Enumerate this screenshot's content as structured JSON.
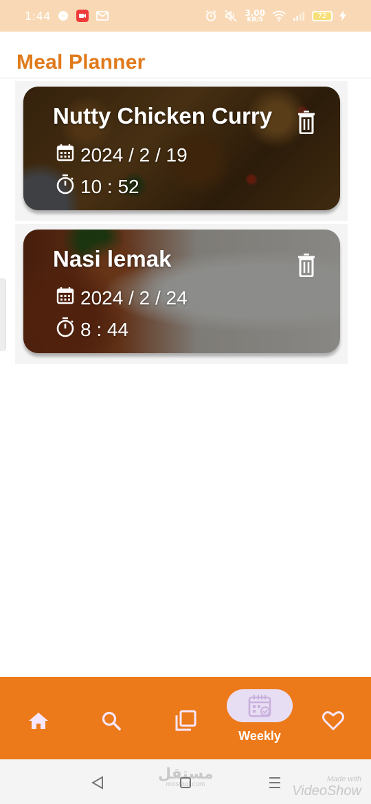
{
  "status_bar": {
    "time": "1:44",
    "speed_value": "3.00",
    "speed_unit": "KB/S",
    "battery": "72",
    "icons": [
      "messenger-icon",
      "screen-record-icon",
      "gmail-icon",
      "alarm-icon",
      "mute-icon",
      "wifi-icon",
      "signal-icon",
      "battery-icon",
      "charging-icon"
    ]
  },
  "app_bar": {
    "title": "Meal Planner"
  },
  "meals": [
    {
      "name": "Nutty Chicken Curry",
      "date": "2024 / 2 / 19",
      "time": "10 : 52",
      "image": "chicken-curry-photo"
    },
    {
      "name": "Nasi lemak",
      "date": "2024 / 2 / 24",
      "time": "8 : 44",
      "image": "nasi-lemak-photo"
    }
  ],
  "bottom_nav": {
    "items": [
      {
        "icon": "home-icon"
      },
      {
        "icon": "search-icon"
      },
      {
        "icon": "plans-icon"
      },
      {
        "icon": "calendar-check-icon",
        "label": "Weekly",
        "selected": true
      },
      {
        "icon": "heart-icon"
      }
    ],
    "colors": {
      "background": "#ec7a1a",
      "selected_pill": "#e8def3"
    }
  },
  "system_nav": {
    "watermark_center": "مستقل",
    "watermark_center_sub": "mostaql.com",
    "watermark_right_small": "Made with",
    "watermark_right_big": "VideoShow"
  },
  "colors": {
    "accent": "#e07a1c",
    "status_bar": "#f9d9b5"
  }
}
